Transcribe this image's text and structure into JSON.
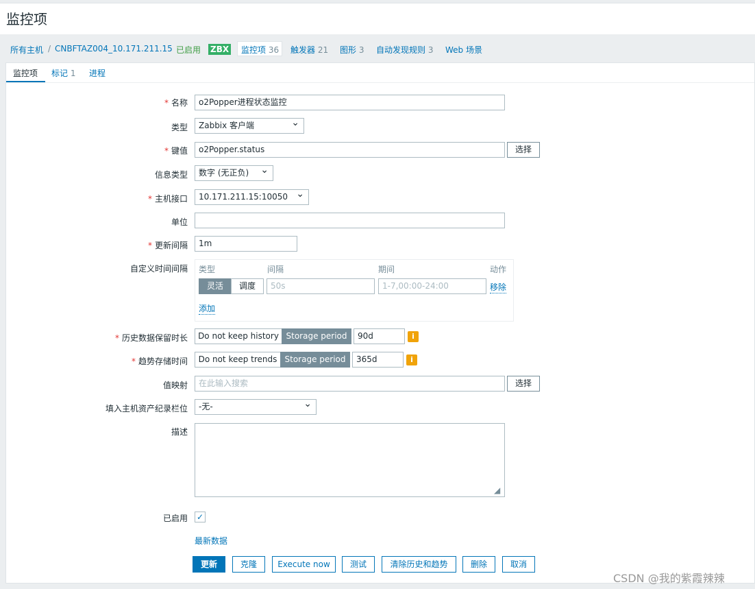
{
  "header": {
    "title": "监控项"
  },
  "breadcrumb": {
    "all_hosts": "所有主机",
    "separator": "/",
    "host": "CNBFTAZ004_10.171.211.15",
    "status": "已启用",
    "zbx": "ZBX",
    "items": "监控项",
    "items_count": "36",
    "triggers": "触发器",
    "triggers_count": "21",
    "graphs": "图形",
    "graphs_count": "3",
    "discovery": "自动发现规则",
    "discovery_count": "3",
    "web": "Web 场景"
  },
  "tabs": [
    {
      "label": "监控项"
    },
    {
      "label": "标记",
      "count": "1"
    },
    {
      "label": "进程"
    }
  ],
  "form": {
    "name_label": "名称",
    "name_value": "o2Popper进程状态监控",
    "type_label": "类型",
    "type_value": "Zabbix 客户端",
    "key_label": "键值",
    "key_value": "o2Popper.status",
    "select_label": "选择",
    "info_type_label": "信息类型",
    "info_type_value": "数字 (无正负)",
    "interface_label": "主机接口",
    "interface_value": "10.171.211.15:10050",
    "units_label": "单位",
    "units_value": "",
    "interval_label": "更新间隔",
    "interval_value": "1m",
    "custom_label": "自定义时间间隔",
    "custom": {
      "col_type": "类型",
      "col_interval": "间隔",
      "col_period": "期间",
      "col_action": "动作",
      "flexible": "灵活",
      "scheduling": "调度",
      "interval_placeholder": "50s",
      "period_placeholder": "1-7,00:00-24:00",
      "remove": "移除",
      "add": "添加"
    },
    "history_label": "历史数据保留时长",
    "history_off": "Do not keep history",
    "history_on": "Storage period",
    "history_value": "90d",
    "trends_label": "趋势存储时间",
    "trends_off": "Do not keep trends",
    "trends_on": "Storage period",
    "trends_value": "365d",
    "valuemap_label": "值映射",
    "valuemap_placeholder": "在此输入搜索",
    "valuemap_select": "选择",
    "inventory_label": "填入主机资产纪录栏位",
    "inventory_value": "-无-",
    "desc_label": "描述",
    "desc_value": "",
    "enabled_label": "已启用",
    "enabled": true,
    "latest_data": "最新数据"
  },
  "actions": {
    "update": "更新",
    "clone": "克隆",
    "execute": "Execute now",
    "test": "测试",
    "clear": "清除历史和趋势",
    "delete": "删除",
    "cancel": "取消"
  },
  "watermark": "CSDN @我的紫霞辣辣",
  "colors": {
    "accent": "#0275b8",
    "enabled": "#429e47",
    "zbx": "#34af67",
    "info": "#f0a30a",
    "segment_on": "#768d99"
  }
}
